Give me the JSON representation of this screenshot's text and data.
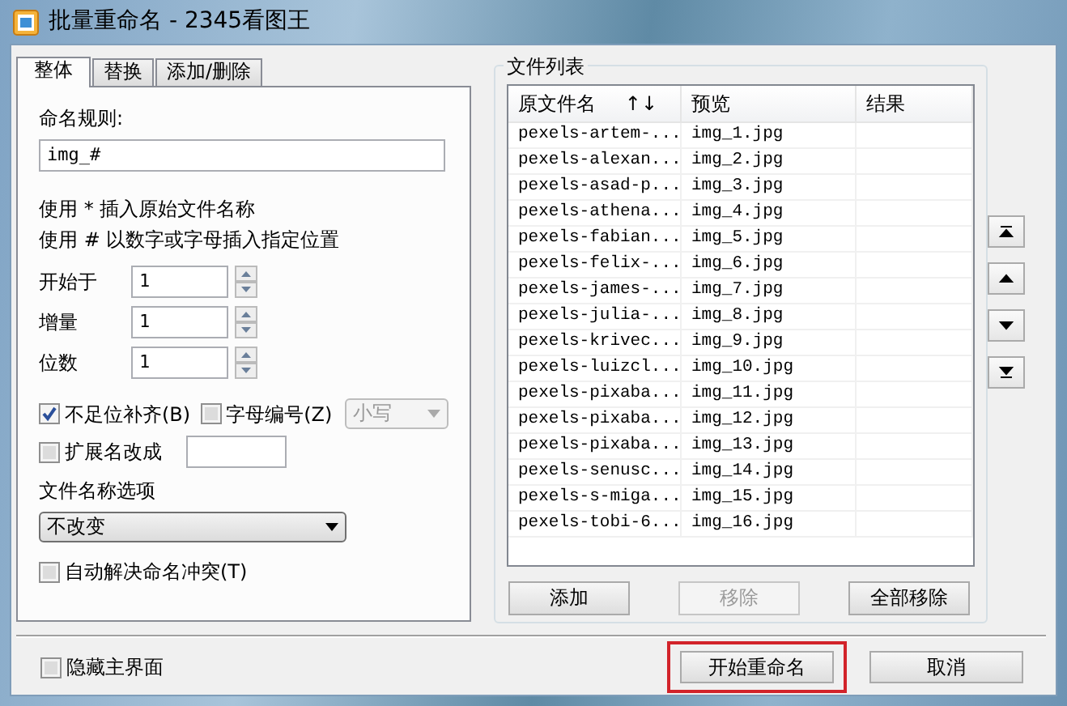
{
  "window": {
    "title": "批量重命名 - 2345看图王"
  },
  "tabs": [
    {
      "label": "整体",
      "selected": true
    },
    {
      "label": "替换",
      "selected": false
    },
    {
      "label": "添加/删除",
      "selected": false
    }
  ],
  "naming_rule": {
    "label": "命名规则:",
    "value": "img_#"
  },
  "hints": [
    "使用 * 插入原始文件名称",
    "使用 # 以数字或字母插入指定位置"
  ],
  "spinners": [
    {
      "label": "开始于",
      "value": "1"
    },
    {
      "label": "增量",
      "value": "1"
    },
    {
      "label": "位数",
      "value": "1"
    }
  ],
  "options": [
    {
      "kind": "checkbox",
      "label": "不足位补齐(B)",
      "checked": true
    },
    {
      "kind": "checkbox",
      "label": "字母编号(Z)",
      "checked": false
    },
    {
      "kind": "select",
      "value": "小写",
      "disabled": true
    }
  ],
  "extension": {
    "label": "扩展名改成",
    "checked": false
  },
  "filename_option": {
    "label": "文件名称选项",
    "value": "不改变"
  },
  "auto_resolve": {
    "label": "自动解决命名冲突(T)",
    "checked": false
  },
  "file_list": {
    "title": "文件列表",
    "columns": [
      {
        "label": "原文件名",
        "sort_mark": "↑↓"
      },
      {
        "label": "预览"
      },
      {
        "label": "结果"
      }
    ],
    "rows": [
      {
        "original": "pexels-artem-...",
        "preview": "img_1.jpg"
      },
      {
        "original": "pexels-alexan...",
        "preview": "img_2.jpg"
      },
      {
        "original": "pexels-asad-p...",
        "preview": "img_3.jpg"
      },
      {
        "original": "pexels-athena...",
        "preview": "img_4.jpg"
      },
      {
        "original": "pexels-fabian...",
        "preview": "img_5.jpg"
      },
      {
        "original": "pexels-felix-...",
        "preview": "img_6.jpg"
      },
      {
        "original": "pexels-james-...",
        "preview": "img_7.jpg"
      },
      {
        "original": "pexels-julia-...",
        "preview": "img_8.jpg"
      },
      {
        "original": "pexels-krivec...",
        "preview": "img_9.jpg"
      },
      {
        "original": "pexels-luizcl...",
        "preview": "img_10.jpg"
      },
      {
        "original": "pexels-pixaba...",
        "preview": "img_11.jpg"
      },
      {
        "original": "pexels-pixaba...",
        "preview": "img_12.jpg"
      },
      {
        "original": "pexels-pixaba...",
        "preview": "img_13.jpg"
      },
      {
        "original": "pexels-senusc...",
        "preview": "img_14.jpg"
      },
      {
        "original": "pexels-s-miga...",
        "preview": "img_15.jpg"
      },
      {
        "original": "pexels-tobi-6...",
        "preview": "img_16.jpg"
      }
    ],
    "buttons": [
      {
        "label": "添加",
        "disabled": false
      },
      {
        "label": "移除",
        "disabled": true
      },
      {
        "label": "全部移除",
        "disabled": false
      }
    ]
  },
  "hide_main": {
    "label": "隐藏主界面",
    "checked": false
  },
  "actions": [
    {
      "label": "开始重命名",
      "highlighted": true
    },
    {
      "label": "取消",
      "highlighted": false
    }
  ]
}
